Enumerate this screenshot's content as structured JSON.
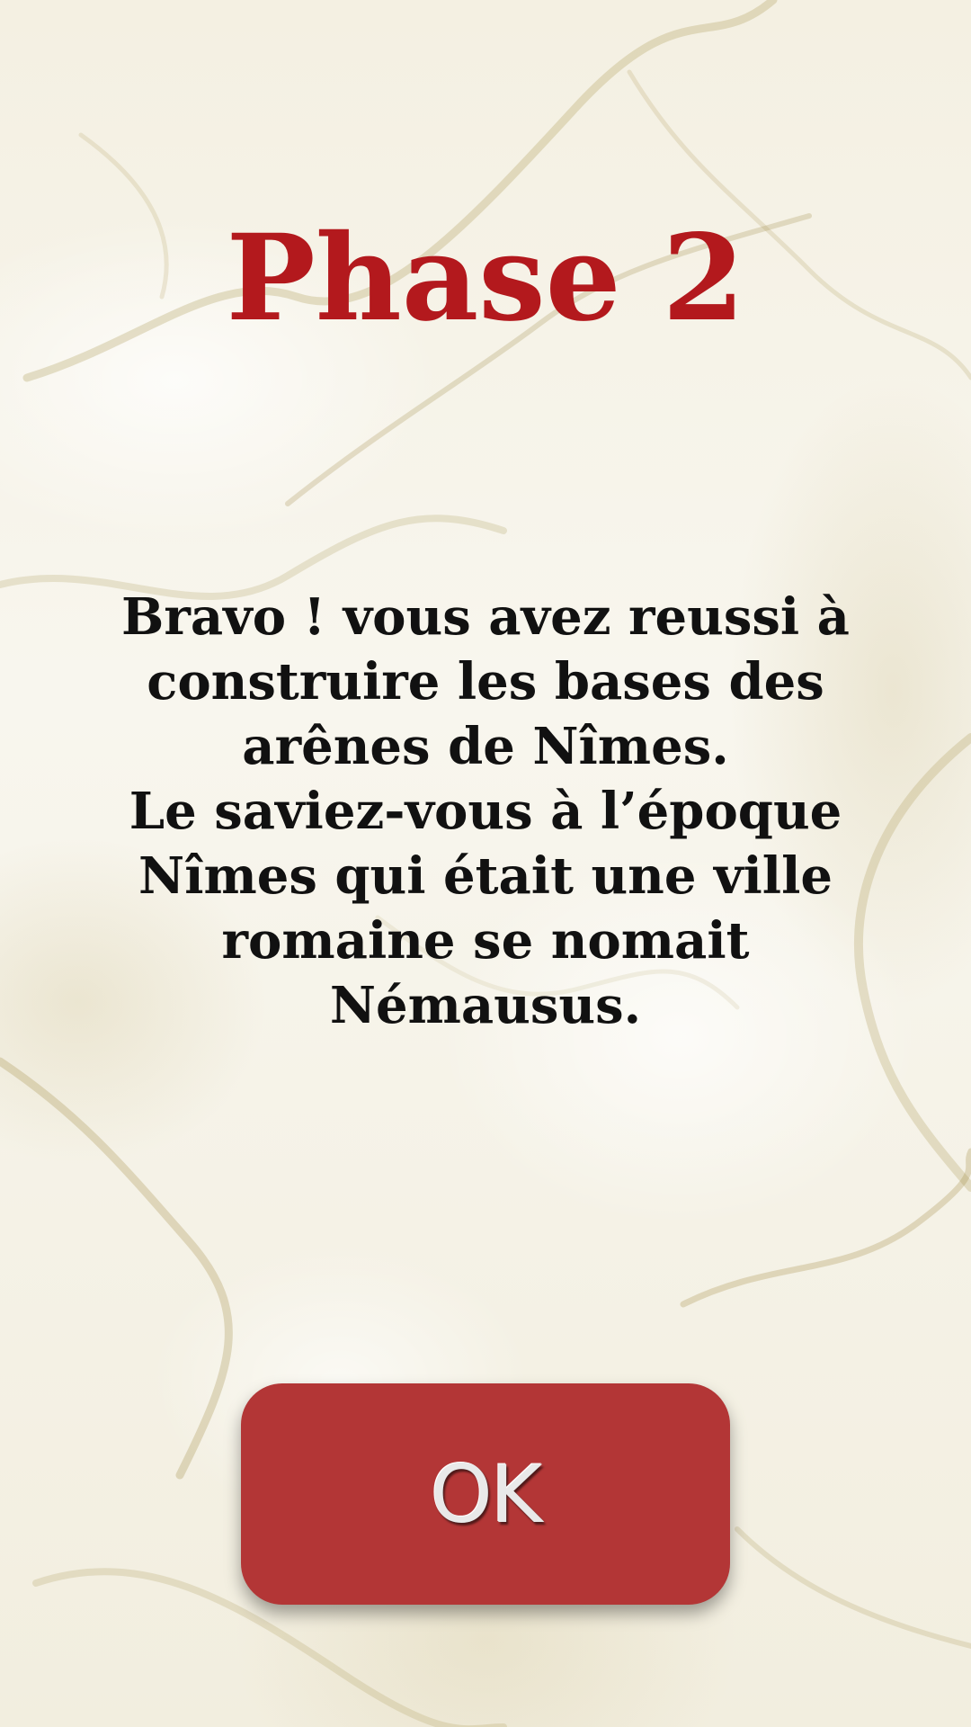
{
  "screen": {
    "title": "Phase 2",
    "message_lines": [
      "Bravo ! vous avez reussi à",
      "construire les bases des",
      "arênes de Nîmes.",
      "Le saviez-vous à l’époque",
      "Nîmes qui était une ville",
      "romaine se nomait",
      "Némausus."
    ],
    "ok_button_label": "OK"
  },
  "colors": {
    "title": "#b3191d",
    "text": "#111111",
    "button": "#b33636",
    "background": "#f6f3e8"
  }
}
